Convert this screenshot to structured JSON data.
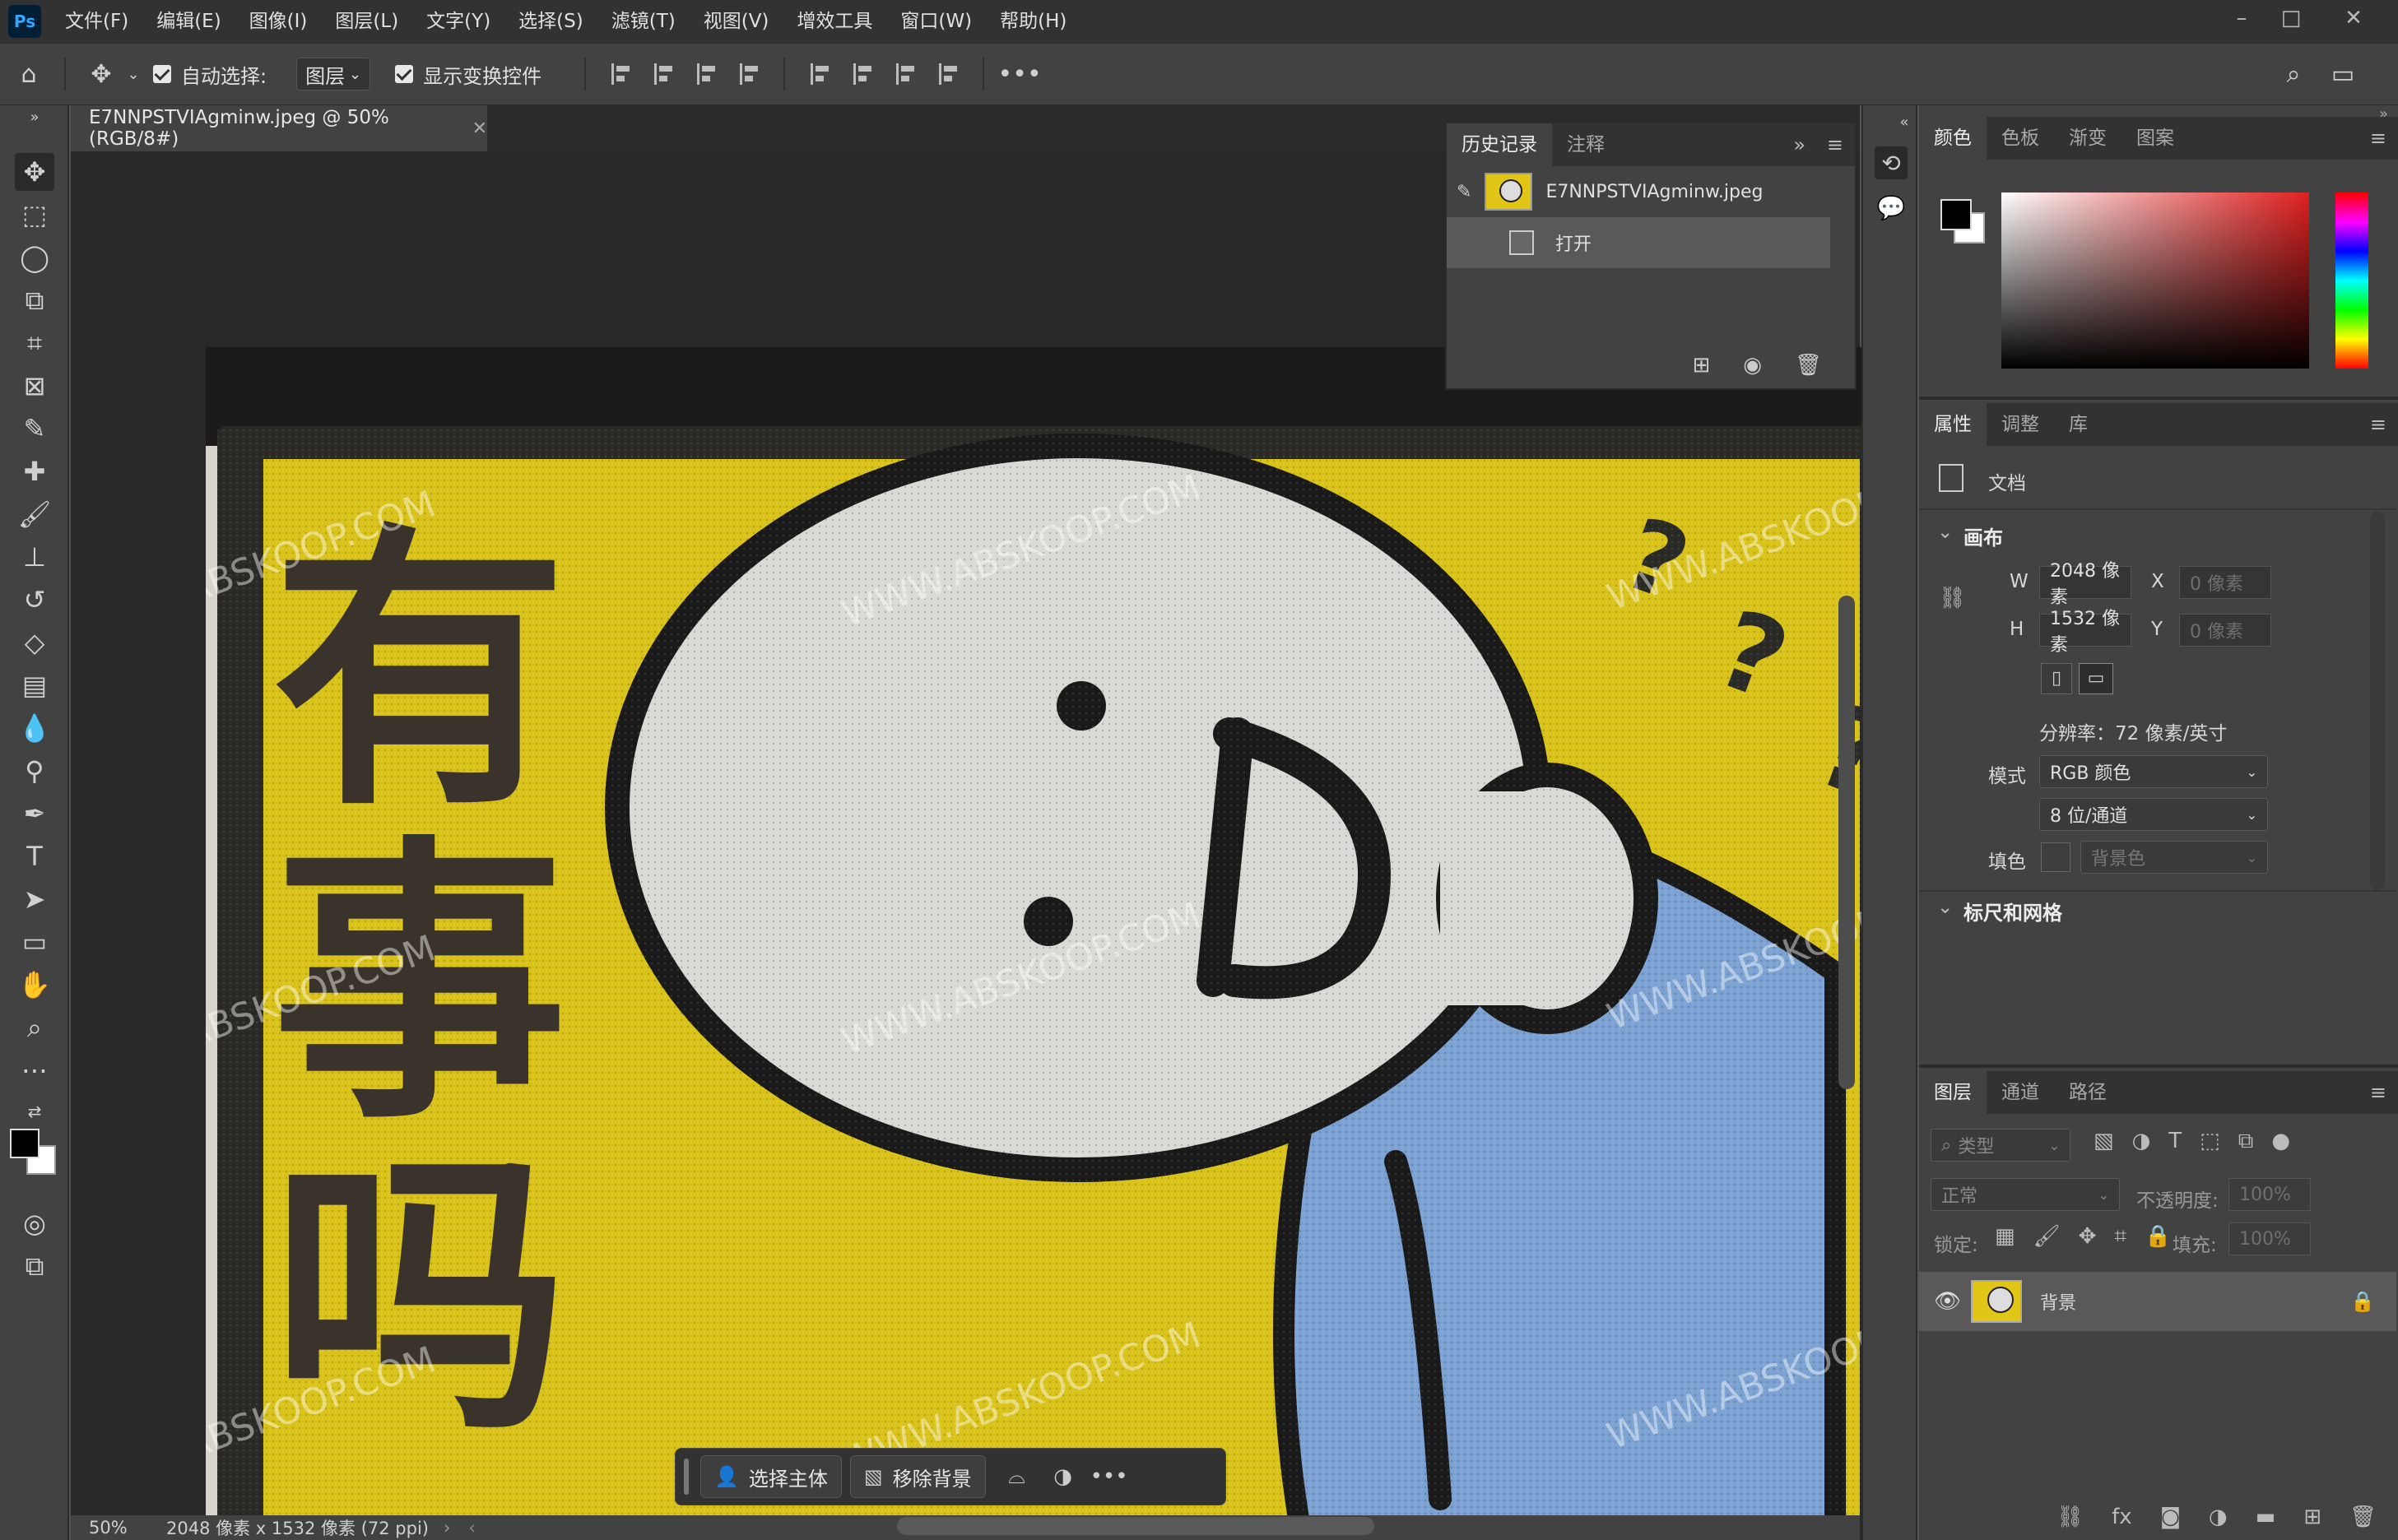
{
  "app": {
    "logo": "Ps",
    "menu": [
      "文件(F)",
      "编辑(E)",
      "图像(I)",
      "图层(L)",
      "文字(Y)",
      "选择(S)",
      "滤镜(T)",
      "视图(V)",
      "增效工具",
      "窗口(W)",
      "帮助(H)"
    ]
  },
  "options": {
    "auto_select_label": "自动选择:",
    "auto_select_target": "图层",
    "show_transform_label": "显示变换控件"
  },
  "document": {
    "tab_title": "E7NNPSTVIAgminw.jpeg @ 50%(RGB/8#)",
    "artwork_text": [
      "有",
      "事",
      "吗"
    ],
    "watermark": "WWW.ABSKOOP.COM"
  },
  "status": {
    "zoom": "50%",
    "info": "2048 像素 x 1532 像素 (72 ppi)"
  },
  "taskbar": {
    "select_subject": "选择主体",
    "remove_bg": "移除背景"
  },
  "history": {
    "tabs": [
      "历史记录",
      "注释"
    ],
    "snapshot_name": "E7NNPSTVIAgminw.jpeg",
    "step": "打开"
  },
  "color_panel": {
    "tabs": [
      "颜色",
      "色板",
      "渐变",
      "图案"
    ],
    "fg_color": "#000000",
    "bg_color": "#ffffff"
  },
  "properties": {
    "tabs": [
      "属性",
      "调整",
      "库"
    ],
    "doc_label": "文档",
    "canvas_section": "画布",
    "w_label": "W",
    "w_value": "2048 像素",
    "h_label": "H",
    "h_value": "1532 像素",
    "x_label": "X",
    "x_placeholder": "0 像素",
    "y_label": "Y",
    "y_placeholder": "0 像素",
    "resolution": "分辨率：72 像素/英寸",
    "mode_label": "模式",
    "mode_value": "RGB 颜色",
    "depth_value": "8 位/通道",
    "fill_label": "填色",
    "fill_value": "背景色",
    "rulers_section": "标尺和网格"
  },
  "layers": {
    "tabs": [
      "图层",
      "通道",
      "路径"
    ],
    "search_placeholder": "类型",
    "blend_mode": "正常",
    "opacity_label": "不透明度:",
    "opacity_value": "100%",
    "lock_label": "锁定:",
    "fill_label": "填充:",
    "fill_value": "100%",
    "layer_name": "背景"
  }
}
